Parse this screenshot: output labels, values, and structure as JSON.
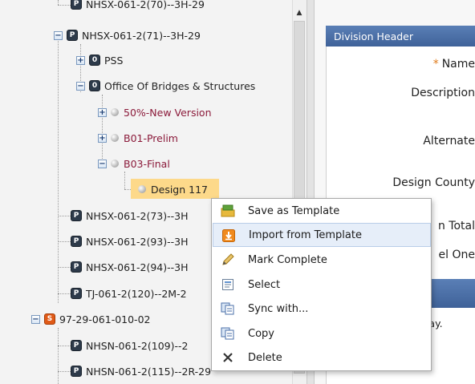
{
  "tree": {
    "nodes": [
      {
        "label": "NHSX-061-2(70)--3H-29",
        "badge": "P"
      },
      {
        "label": "NHSX-061-2(71)--3H-29",
        "badge": "P",
        "toggle": "-"
      },
      {
        "label": "PSS",
        "badge": "0",
        "toggle": "+"
      },
      {
        "label": "Office Of Bridges & Structures",
        "badge": "0",
        "toggle": "-"
      },
      {
        "label": "50%-New Version",
        "toggle": "+"
      },
      {
        "label": "B01-Prelim",
        "toggle": "+"
      },
      {
        "label": "B03-Final",
        "toggle": "-"
      },
      {
        "label": "Design 117"
      },
      {
        "label": "NHSX-061-2(73)--3H",
        "badge": "P"
      },
      {
        "label": "NHSX-061-2(93)--3H",
        "badge": "P"
      },
      {
        "label": "NHSX-061-2(94)--3H",
        "badge": "P"
      },
      {
        "label": "TJ-061-2(120)--2M-2",
        "badge": "P"
      },
      {
        "label": "97-29-061-010-02",
        "badge": "S",
        "toggle": "-"
      },
      {
        "label": "NHSN-061-2(109)--2",
        "badge": "P"
      },
      {
        "label": "NHSN-061-2(115)--2R-29",
        "badge": "P"
      }
    ]
  },
  "right_panel": {
    "header": "Division Header",
    "required_mark": "*",
    "labels": {
      "name": "Name",
      "description": "Description",
      "alternate": "Alternate",
      "design_county": "Design County",
      "total": "n Total",
      "level_one": "el One"
    },
    "display_text": "play."
  },
  "context_menu": {
    "items": [
      {
        "label": "Save as Template",
        "icon": "save-template-icon"
      },
      {
        "label": "Import from Template",
        "icon": "import-icon"
      },
      {
        "label": "Mark Complete",
        "icon": "pencil-icon"
      },
      {
        "label": "Select",
        "icon": "select-icon"
      },
      {
        "label": "Sync with...",
        "icon": "sync-icon"
      },
      {
        "label": "Copy",
        "icon": "copy-icon"
      },
      {
        "label": "Delete",
        "icon": "delete-icon"
      }
    ],
    "hovered_index": 1
  },
  "colors": {
    "header_blue": "#4a6fa8",
    "selected_node": "#fdd98a",
    "maroon_text": "#8b1a3a",
    "required_star": "#e07b1a"
  }
}
